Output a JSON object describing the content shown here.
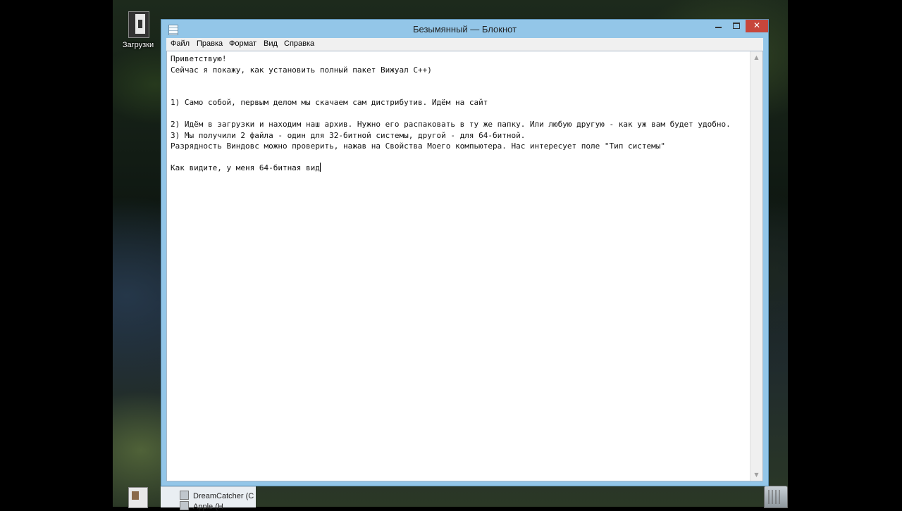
{
  "desktop": {
    "icons": [
      {
        "label": "Загрузки",
        "icon": "downloads-folder-icon"
      }
    ],
    "recycle_bin_icon": "recycle-bin-icon"
  },
  "window": {
    "title": "Безымянный — Блокнот",
    "app_icon": "notepad-icon",
    "controls": {
      "minimize_icon": "minimize-icon",
      "maximize_icon": "maximize-icon",
      "close_label": "✕"
    }
  },
  "menu": {
    "items": [
      "Файл",
      "Правка",
      "Формат",
      "Вид",
      "Справка"
    ]
  },
  "editor": {
    "lines": [
      "Приветствую!",
      "Сейчас я покажу, как установить полный пакет Вижуал С++)",
      "",
      "",
      "1) Само собой, первым делом мы скачаем сам дистрибутив. Идём на сайт",
      "",
      "2) Идём в загрузки и находим наш архив. Нужно его распаковать в ту же папку. Или любую другую - как уж вам будет удобно.",
      "3) Мы получили 2 файла - один для 32-битной системы, другой - для 64-битной.",
      "Разрядность Виндовс можно проверить, нажав на Свойства Моего компьютера. Нас интересует поле \"Тип системы\"",
      "",
      "Как видите, у меня 64-битная вид"
    ]
  },
  "taskbar_jumplist": {
    "items": [
      "DreamCatcher (C",
      "Apple (H"
    ]
  }
}
